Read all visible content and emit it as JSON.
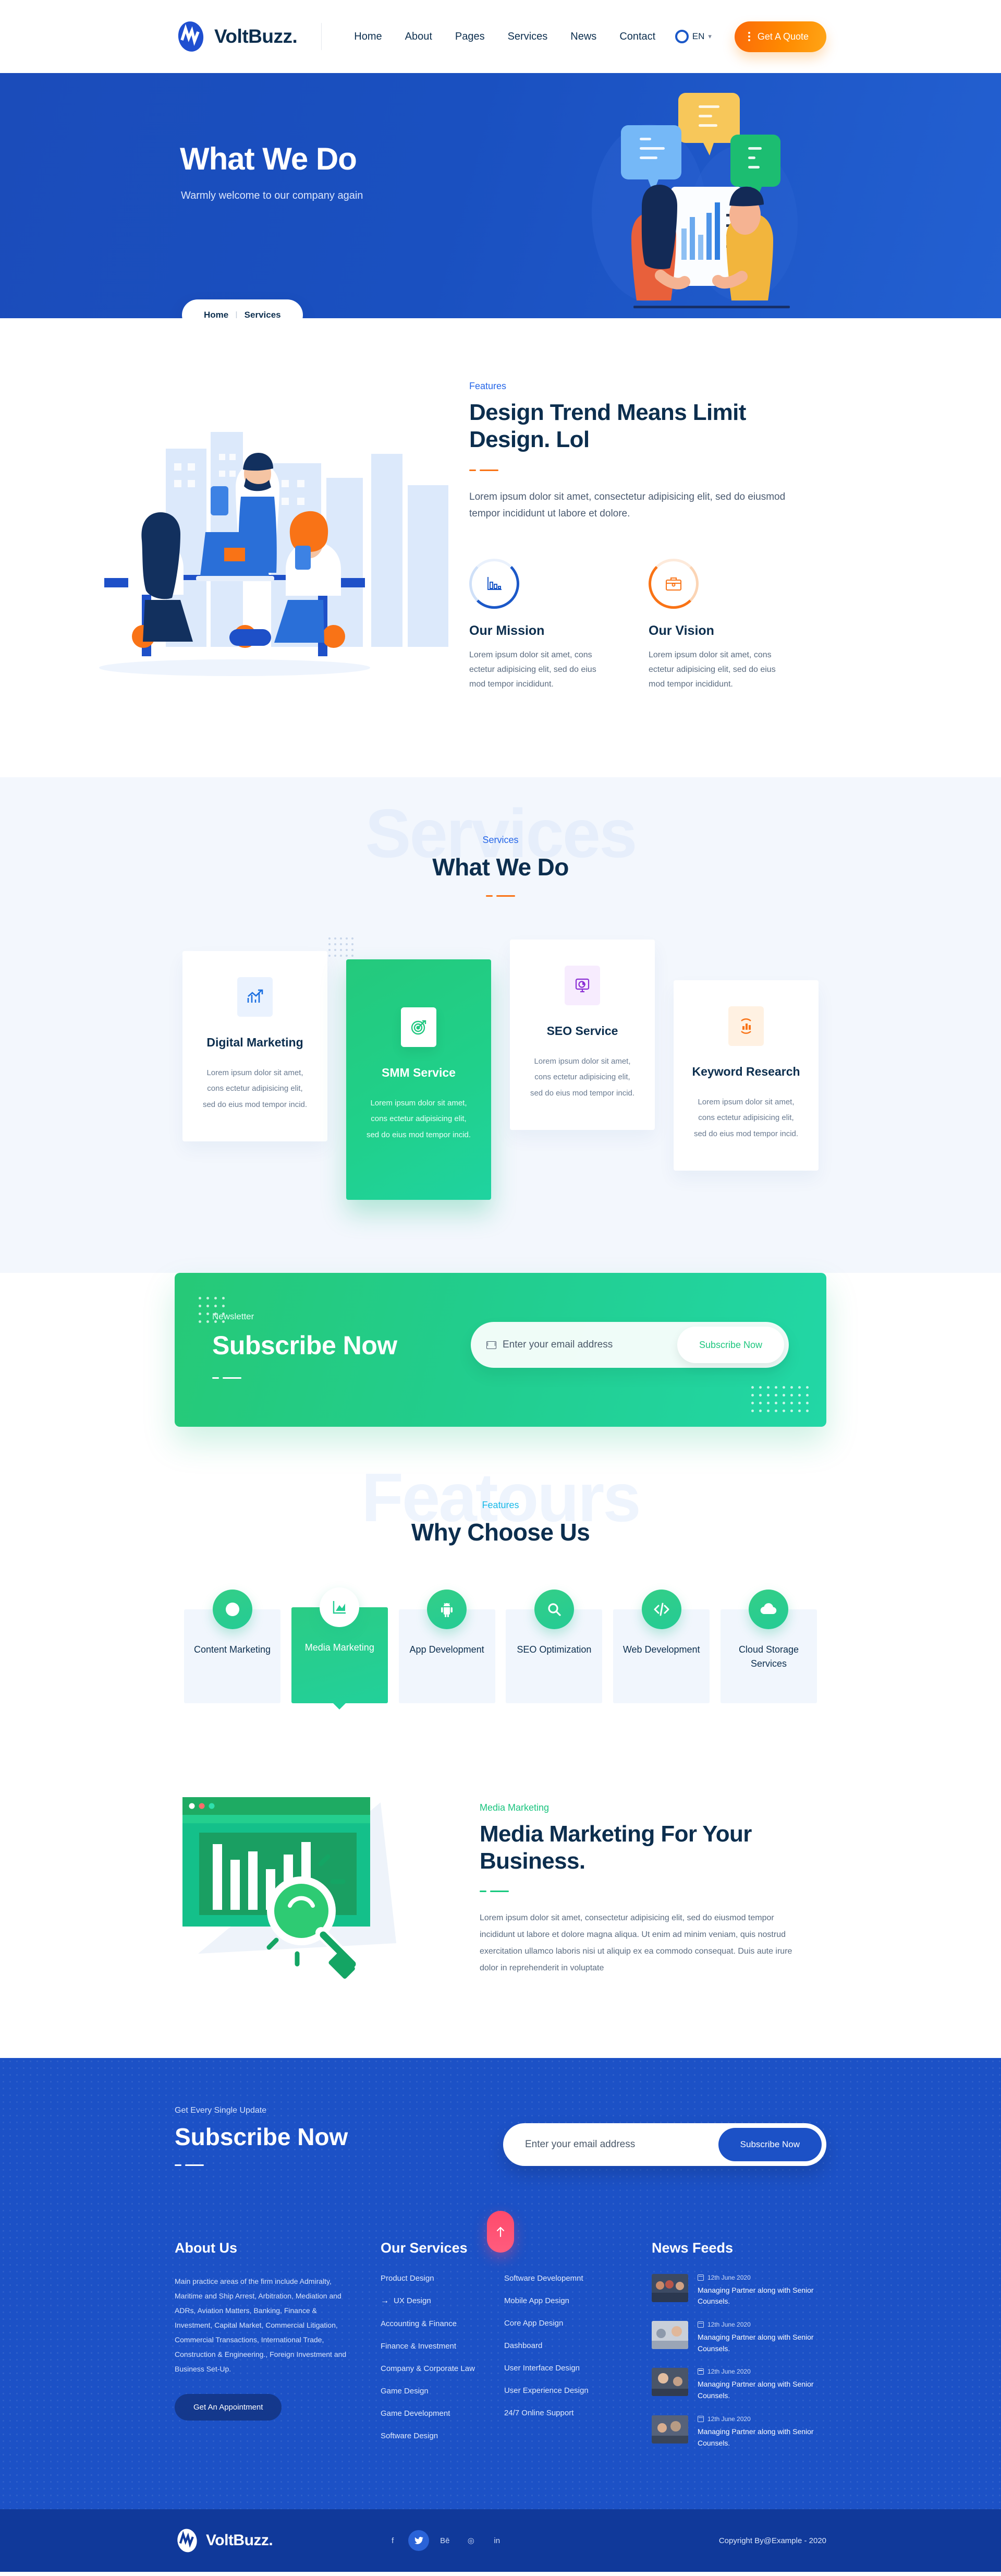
{
  "brand": {
    "name": "VoltBuzz.",
    "logo_icon": "voltbuzz-wave-logo"
  },
  "header": {
    "nav": [
      {
        "label": "Home"
      },
      {
        "label": "About"
      },
      {
        "label": "Pages"
      },
      {
        "label": "Services"
      },
      {
        "label": "News"
      },
      {
        "label": "Contact"
      }
    ],
    "language": {
      "label": "EN",
      "caret": "⌄",
      "icon": "globe-icon"
    },
    "quote_button": "Get A Quote"
  },
  "hero": {
    "title": "What We Do",
    "subtitle": "Warmly welcome to our company again",
    "breadcrumb": {
      "home": "Home",
      "separator": "|",
      "current": "Services"
    },
    "illustration": "two-people-discussing-chart-with-speech-bubbles"
  },
  "about": {
    "eyebrow": "Features",
    "title": "Design Trend Means Limit Design. Lol",
    "lead": "Lorem ipsum dolor sit amet, consectetur adipisicing elit, sed do eiusmod tempor incididunt ut labore et dolore.",
    "illustration": "team-meeting-city-skyline-illustration",
    "cards": [
      {
        "icon": "bar-chart-icon",
        "title": "Our Mission",
        "text": "Lorem ipsum dolor sit amet, cons ectetur adipisicing elit, sed do eius mod tempor incididunt."
      },
      {
        "icon": "briefcase-icon",
        "title": "Our Vision",
        "text": "Lorem ipsum dolor sit amet, cons ectetur adipisicing elit, sed do eius mod tempor incididunt."
      }
    ]
  },
  "services": {
    "ghost_text": "Services",
    "eyebrow": "Services",
    "title": "What We Do",
    "items": [
      {
        "icon": "growth-chart-icon",
        "title": "Digital Marketing",
        "text": "Lorem ipsum dolor sit amet, cons ectetur adipisicing elit, sed do eius mod tempor incid.",
        "active": false
      },
      {
        "icon": "target-dart-icon",
        "title": "SMM Service",
        "text": "Lorem ipsum dolor sit amet, cons ectetur adipisicing elit, sed do eius mod tempor incid.",
        "active": true
      },
      {
        "icon": "monitor-pie-icon",
        "title": "SEO Service",
        "text": "Lorem ipsum dolor sit amet, cons ectetur adipisicing elit, sed do eius mod tempor incid.",
        "active": false
      },
      {
        "icon": "keyword-bars-icon",
        "title": "Keyword Research",
        "text": "Lorem ipsum dolor sit amet, cons ectetur adipisicing elit, sed do eius mod tempor incid.",
        "active": false
      }
    ]
  },
  "newsletter_green": {
    "eyebrow": "Newsletter",
    "title": "Subscribe Now",
    "input_placeholder": "Enter your email address",
    "input_value": "",
    "button": "Subscribe Now",
    "mail_icon": "envelope-icon"
  },
  "why": {
    "ghost_text": "Featours",
    "eyebrow": "Features",
    "title": "Why Choose Us",
    "items": [
      {
        "icon": "pie-chart-icon",
        "label": "Content Marketing",
        "active": false
      },
      {
        "icon": "area-chart-icon",
        "label": "Media Marketing",
        "active": true
      },
      {
        "icon": "android-icon",
        "label": "App Development",
        "active": false
      },
      {
        "icon": "magnifier-icon",
        "label": "SEO Optimization",
        "active": false
      },
      {
        "icon": "code-brackets-icon",
        "label": "Web Development",
        "active": false
      },
      {
        "icon": "cloud-icon",
        "label": "Cloud Storage Services",
        "active": false
      }
    ]
  },
  "media_marketing": {
    "eyebrow": "Media Marketing",
    "title": "Media Marketing For Your Business.",
    "text": "Lorem ipsum dolor sit amet, consectetur adipisicing elit, sed do eiusmod tempor incididunt ut labore et dolore magna aliqua. Ut enim ad minim veniam, quis nostrud exercitation ullamco laboris nisi ut aliquip ex ea commodo consequat. Duis aute irure dolor in reprehenderit in voluptate",
    "illustration": "browser-bar-chart-with-magnifier"
  },
  "footer_subscribe": {
    "eyebrow": "Get Every Single Update",
    "title": "Subscribe Now",
    "input_placeholder": "Enter your email address",
    "input_value": "",
    "button": "Subscribe Now",
    "mail_icon": "envelope-icon",
    "scroll_top_icon": "arrow-up-icon"
  },
  "footer": {
    "about": {
      "heading": "About Us",
      "text": "Main practice areas of the firm include Admiralty, Maritime and Ship Arrest, Arbitration, Mediation and ADRs, Aviation Matters, Banking, Finance & Investment, Capital Market, Commercial Litigation, Commercial Transactions, International Trade, Construction & Engineering., Foreign Investment and Business Set-Up.",
      "button": "Get An Appointment"
    },
    "services": {
      "heading": "Our Services",
      "col1": [
        {
          "label": "Product Design",
          "arrow": false
        },
        {
          "label": "UX Design",
          "arrow": true
        },
        {
          "label": "Accounting & Finance",
          "arrow": false
        },
        {
          "label": "Finance & Investment",
          "arrow": false
        },
        {
          "label": "Company & Corporate Law",
          "arrow": false
        },
        {
          "label": "Game Design",
          "arrow": false
        },
        {
          "label": "Game Development",
          "arrow": false
        },
        {
          "label": "Software Design",
          "arrow": false
        }
      ],
      "col2": [
        {
          "label": "Software Developemnt",
          "arrow": false
        },
        {
          "label": "Mobile App Design",
          "arrow": false
        },
        {
          "label": "Core App Design",
          "arrow": false
        },
        {
          "label": "Dashboard",
          "arrow": false
        },
        {
          "label": "User Interface Design",
          "arrow": false
        },
        {
          "label": "User Experience Design",
          "arrow": false
        },
        {
          "label": "24/7 Online Support",
          "arrow": false
        }
      ]
    },
    "news": {
      "heading": "News Feeds",
      "items": [
        {
          "date": "12th June 2020",
          "title": "Managing Partner along with Senior Counsels.",
          "thumb": "business-meeting-photo-1"
        },
        {
          "date": "12th June 2020",
          "title": "Managing Partner along with Senior Counsels.",
          "thumb": "business-meeting-photo-2"
        },
        {
          "date": "12th June 2020",
          "title": "Managing Partner along with Senior Counsels.",
          "thumb": "business-meeting-photo-3"
        },
        {
          "date": "12th June 2020",
          "title": "Managing Partner along with Senior Counsels.",
          "thumb": "business-meeting-photo-4"
        }
      ]
    },
    "bottom": {
      "copyright": "Copyright By@Example - 2020",
      "socials": [
        {
          "icon": "facebook-icon",
          "glyph": "f",
          "active": false
        },
        {
          "icon": "twitter-icon",
          "glyph": "🐦",
          "active": true
        },
        {
          "icon": "behance-icon",
          "glyph": "Bē",
          "active": false
        },
        {
          "icon": "dribbble-icon",
          "glyph": "◎",
          "active": false
        },
        {
          "icon": "linkedin-icon",
          "glyph": "in",
          "active": false
        }
      ]
    }
  },
  "colors": {
    "primary_blue": "#1c51c6",
    "hero_blue": "#1b4cba",
    "deep_navy": "#0c2e4e",
    "accent_orange": "#f97316",
    "accent_green": "#22cd8d",
    "light_blue_bg": "#f3f7fd",
    "footer_bottom": "#10399a",
    "scroll_top_pink": "#ff5070"
  }
}
